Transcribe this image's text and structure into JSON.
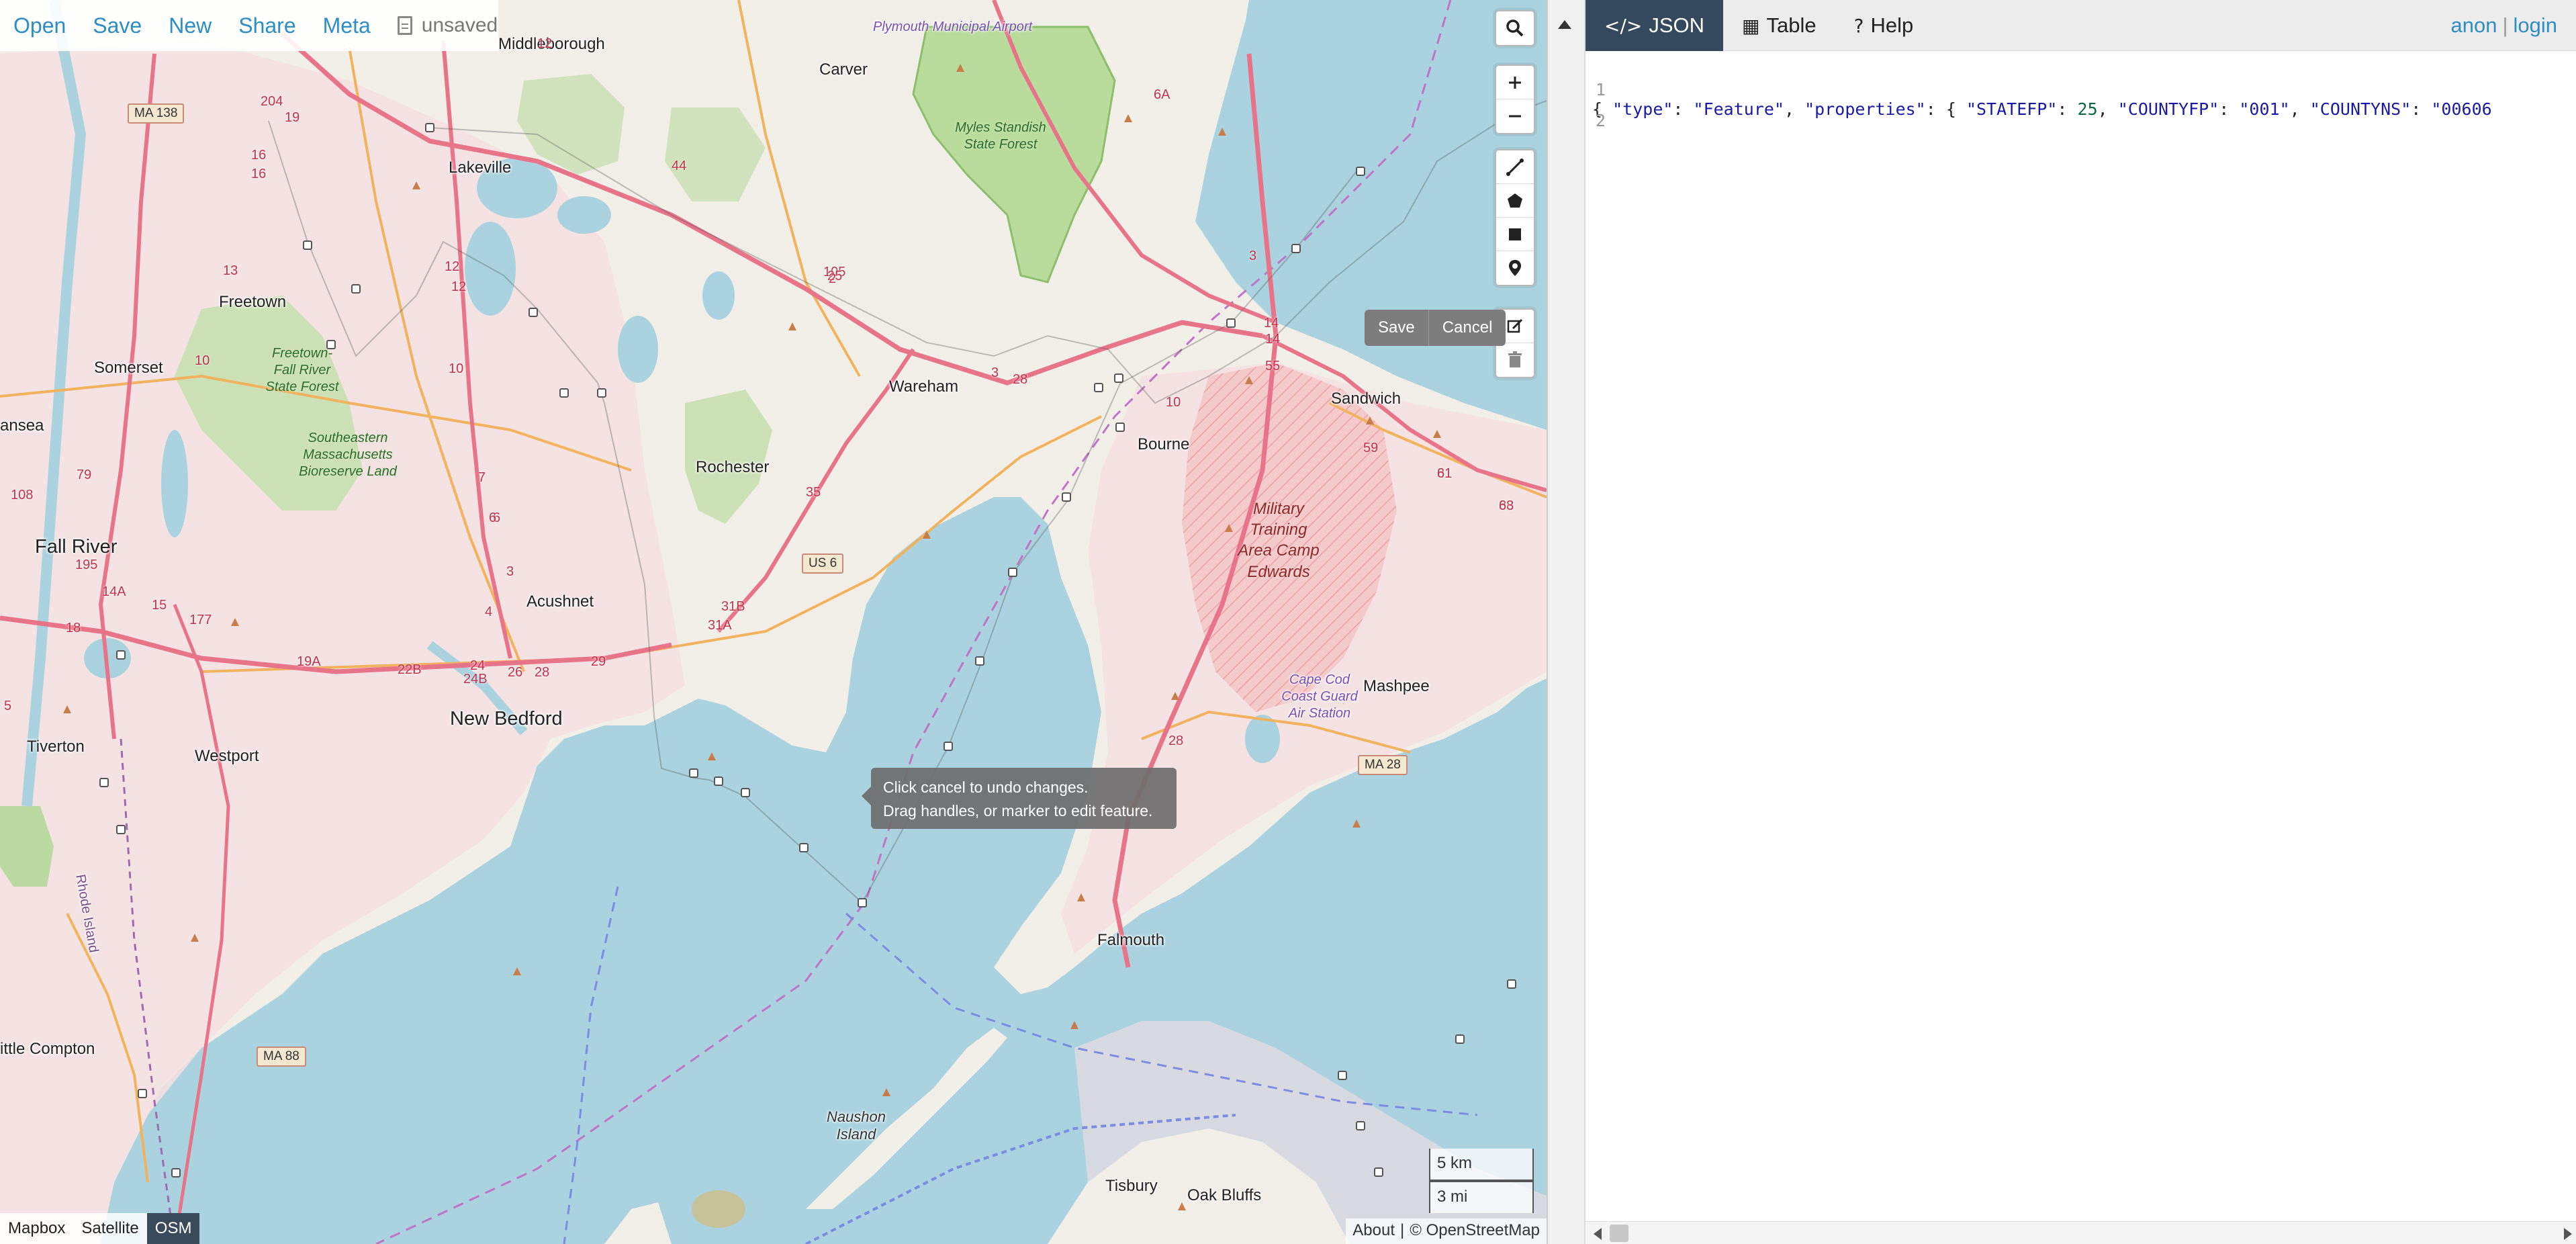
{
  "menu": {
    "items": [
      "Open",
      "Save",
      "New",
      "Share",
      "Meta"
    ],
    "file_status": "unsaved"
  },
  "map": {
    "edit_actions": {
      "save": "Save",
      "cancel": "Cancel"
    },
    "tooltip": {
      "line1": "Click cancel to undo changes.",
      "line2": "Drag handles, or marker to edit feature."
    },
    "scale": {
      "metric": "5 km",
      "imperial": "3 mi"
    },
    "layers": [
      "Mapbox",
      "Satellite",
      "OSM"
    ],
    "active_layer": "OSM",
    "attribution": {
      "about": "About",
      "sep": "|",
      "credit": "© OpenStreetMap"
    },
    "labels": {
      "plymouth_airport": "Plymouth Municipal Airport",
      "middleborough": "Middleborough",
      "carver": "Carver",
      "myles_standish": "Myles Standish State Forest",
      "lakeville": "Lakeville",
      "freetown": "Freetown",
      "somerset": "Somerset",
      "freetown_forest": "Freetown- Fall River State Forest",
      "bioreserve": "Southeastern Massachusetts Bioreserve Land",
      "swansea": "ansea",
      "fall_river": "Fall River",
      "rochester": "Rochester",
      "wareham": "Wareham",
      "bourne": "Bourne",
      "sandwich": "Sandwich",
      "military": "Military Training Area Camp Edwards",
      "cape_cod_cg": "Cape Cod Coast Guard Air Station",
      "mashpee": "Mashpee",
      "acushnet": "Acushnet",
      "new_bedford": "New Bedford",
      "westport": "Westport",
      "tiverton": "Tiverton",
      "rhode_island": "Rhode Island",
      "falmouth": "Falmouth",
      "little_compton": "ittle Compton",
      "naushon": "Naushon Island",
      "tisbury": "Tisbury",
      "oak_bluffs": "Oak Bluffs"
    },
    "shields": {
      "ma138": "MA 138",
      "us6": "US 6",
      "ma28": "MA 28",
      "ma88": "MA 88"
    },
    "routes": [
      "12",
      "204",
      "19",
      "16",
      "16",
      "13",
      "10",
      "12",
      "12",
      "10",
      "6",
      "4",
      "3",
      "7",
      "6",
      "24",
      "24B",
      "22B",
      "26",
      "28",
      "29",
      "18",
      "14A",
      "15",
      "195",
      "5",
      "108",
      "79",
      "81",
      "88",
      "177",
      "19A",
      "44",
      "105",
      "35",
      "31B",
      "31A",
      "25",
      "3",
      "28",
      "3",
      "14",
      "14",
      "55",
      "10",
      "59",
      "61",
      "63",
      "28",
      "6A",
      "2"
    ]
  },
  "panel": {
    "tabs": [
      {
        "label": "JSON",
        "icon": "code-icon"
      },
      {
        "label": "Table",
        "icon": "table-icon"
      },
      {
        "label": "Help",
        "icon": "question-icon"
      }
    ],
    "active_tab": "JSON",
    "user": {
      "anon": "anon",
      "sep": "|",
      "login": "login"
    },
    "code_lines": [
      {
        "n": "1"
      },
      {
        "n": "2"
      }
    ],
    "code": {
      "p1": "{ ",
      "k1": "\"type\"",
      "c1": ": ",
      "v1": "\"Feature\"",
      "c2": ", ",
      "k2": "\"properties\"",
      "c3": ": { ",
      "k3": "\"STATEFP\"",
      "c4": ": ",
      "v3": "25",
      "c5": ", ",
      "k4": "\"COUNTYFP\"",
      "c6": ": ",
      "v4": "\"001\"",
      "c7": ", ",
      "k5": "\"COUNTYNS\"",
      "c8": ": ",
      "v5": "\"00606"
    }
  },
  "colors": {
    "water": "#aad3df",
    "land": "#f2efe9",
    "urban": "#f7dfe0",
    "park": "#c8e0b0",
    "road_primary": "#e8748a",
    "road_secondary": "#f2b35e",
    "tab_active": "#34495e",
    "link": "#2d8ec7"
  }
}
